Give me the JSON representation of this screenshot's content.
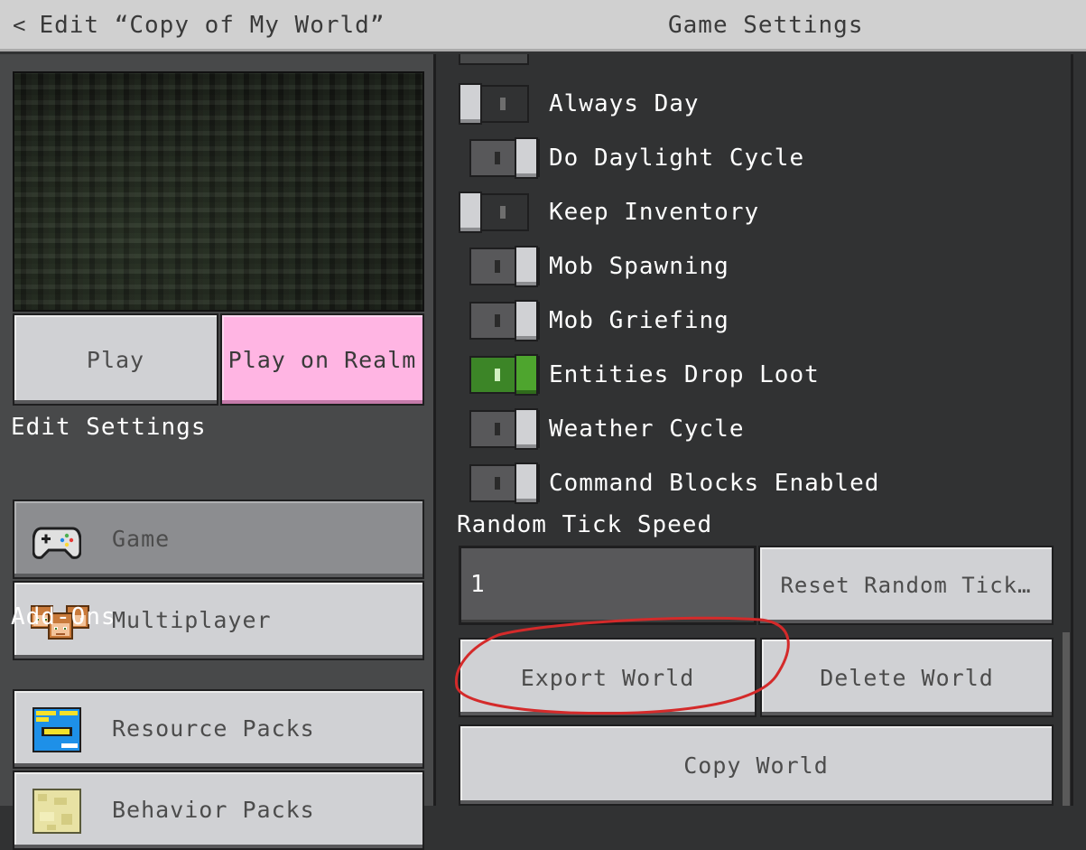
{
  "header": {
    "back_label": "Edit “Copy of My World”",
    "title": "Game Settings"
  },
  "left": {
    "play_label": "Play",
    "realm_label": "Play on Realm",
    "edit_settings_heading": "Edit Settings",
    "addons_heading": "Add-Ons",
    "nav": {
      "game": "Game",
      "multiplayer": "Multiplayer",
      "resource_packs": "Resource Packs",
      "behavior_packs": "Behavior Packs"
    },
    "resource_pack_icon_text": [
      "LET'S",
      "GO",
      "!!!!"
    ]
  },
  "settings": {
    "toggles": [
      {
        "label": "Always Day",
        "state": "off"
      },
      {
        "label": "Do Daylight Cycle",
        "state": "on"
      },
      {
        "label": "Keep Inventory",
        "state": "off"
      },
      {
        "label": "Mob Spawning",
        "state": "on"
      },
      {
        "label": "Mob Griefing",
        "state": "on"
      },
      {
        "label": "Entities Drop Loot",
        "state": "on-green"
      },
      {
        "label": "Weather Cycle",
        "state": "on"
      },
      {
        "label": "Command Blocks Enabled",
        "state": "on"
      }
    ],
    "random_tick_label": "Random Tick Speed",
    "random_tick_value": "1",
    "reset_tick_label": "Reset Random Tick…",
    "export_label": "Export World",
    "delete_label": "Delete World",
    "copy_label": "Copy World"
  },
  "colors": {
    "realm_pink": "#ffb5e3",
    "toggle_green": "#4ea52e",
    "annotation_red": "#d42a2a"
  }
}
